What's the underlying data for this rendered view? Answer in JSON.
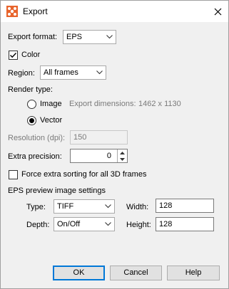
{
  "window": {
    "title": "Export"
  },
  "export_format": {
    "label": "Export format:",
    "value": "EPS"
  },
  "color": {
    "label": "Color",
    "checked": true
  },
  "region": {
    "label": "Region:",
    "value": "All frames"
  },
  "render_type": {
    "label": "Render type:",
    "image_label": "Image",
    "dimensions_label": "Export dimensions:",
    "dimensions_value": "1462 x 1130",
    "vector_label": "Vector",
    "selected": "Vector"
  },
  "resolution": {
    "label": "Resolution (dpi):",
    "value": "150"
  },
  "extra_precision": {
    "label": "Extra precision:",
    "value": "0"
  },
  "force_sorting": {
    "label": "Force extra sorting for all 3D frames",
    "checked": false
  },
  "preview": {
    "heading": "EPS preview image settings",
    "type_label": "Type:",
    "type_value": "TIFF",
    "width_label": "Width:",
    "width_value": "128",
    "depth_label": "Depth:",
    "depth_value": "On/Off",
    "height_label": "Height:",
    "height_value": "128"
  },
  "buttons": {
    "ok": "OK",
    "cancel": "Cancel",
    "help": "Help"
  },
  "icons": {
    "app": "tecplot-app-icon",
    "close": "close-icon",
    "dropdown": "chevron-down-icon",
    "check": "check-icon"
  }
}
